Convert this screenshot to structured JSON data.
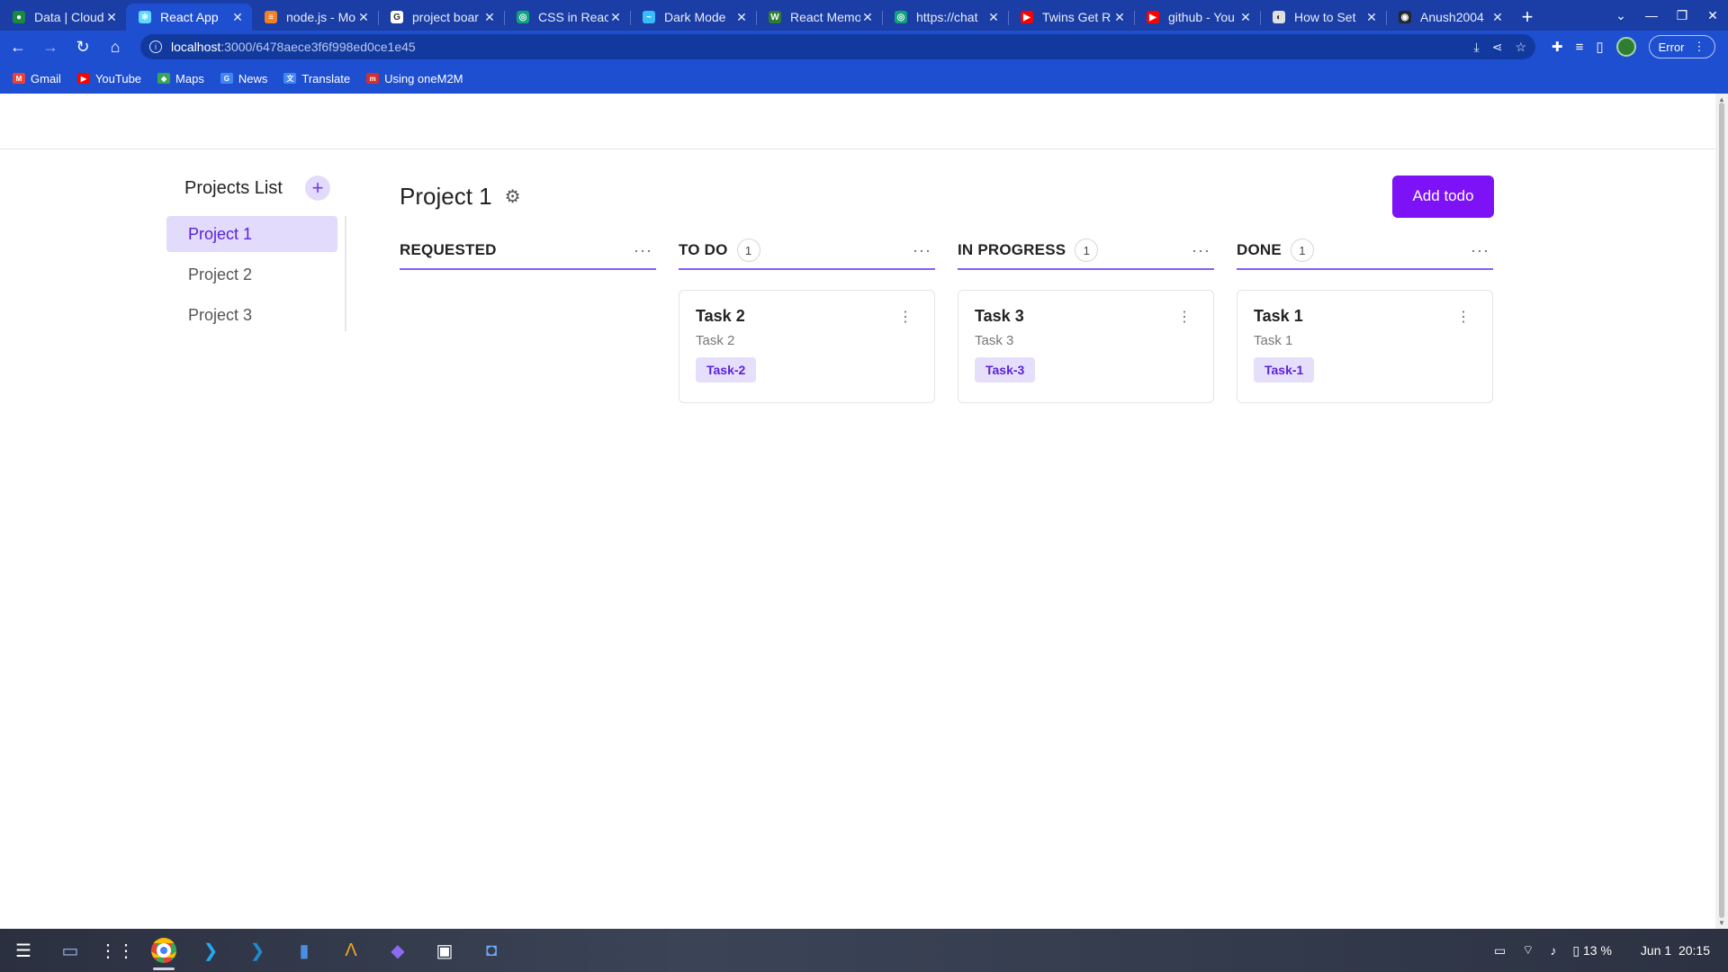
{
  "browser": {
    "tabs": [
      {
        "label": "Data | Cloud",
        "color": "#1b8a3f",
        "glyph": "●"
      },
      {
        "label": "React App",
        "color": "#61dafb",
        "glyph": "⚛",
        "active": true
      },
      {
        "label": "node.js - Mo",
        "color": "#f48024",
        "glyph": "≡"
      },
      {
        "label": "project boar",
        "color": "#ffffff",
        "glyph": "G"
      },
      {
        "label": "CSS in React",
        "color": "#10a37f",
        "glyph": "◎"
      },
      {
        "label": "Dark Mode",
        "color": "#38bdf8",
        "glyph": "~"
      },
      {
        "label": "React Memo",
        "color": "#2e7d32",
        "glyph": "W"
      },
      {
        "label": "https://chat",
        "color": "#10a37f",
        "glyph": "◎"
      },
      {
        "label": "Twins Get R",
        "color": "#ff0000",
        "glyph": "▶"
      },
      {
        "label": "github - You",
        "color": "#ff0000",
        "glyph": "▶"
      },
      {
        "label": "How to Set",
        "color": "#e0e0e0",
        "glyph": "◐"
      },
      {
        "label": "Anush2004",
        "color": "#24292f",
        "glyph": "◉"
      }
    ],
    "new_tab": "+",
    "url_host": "localhost",
    "url_path": ":3000/6478aece3f6f998ed0ce1e45",
    "error_label": "Error",
    "bookmarks": [
      {
        "label": "Gmail",
        "color": "#ea4335",
        "glyph": "M"
      },
      {
        "label": "YouTube",
        "color": "#ff0000",
        "glyph": "▶"
      },
      {
        "label": "Maps",
        "color": "#34a853",
        "glyph": "◆"
      },
      {
        "label": "News",
        "color": "#4285f4",
        "glyph": "G"
      },
      {
        "label": "Translate",
        "color": "#4285f4",
        "glyph": "文"
      },
      {
        "label": "Using oneM2M",
        "color": "#d32f2f",
        "glyph": "m"
      }
    ]
  },
  "sidebar": {
    "title": "Projects List",
    "add_glyph": "+",
    "projects": [
      "Project 1",
      "Project 2",
      "Project 3"
    ],
    "active_index": 0
  },
  "main": {
    "title": "Project 1",
    "add_todo_label": "Add todo",
    "columns": [
      {
        "title": "REQUESTED",
        "count": null,
        "cards": []
      },
      {
        "title": "TO DO",
        "count": "1",
        "cards": [
          {
            "title": "Task 2",
            "desc": "Task 2",
            "tag": "Task-2"
          }
        ]
      },
      {
        "title": "IN PROGRESS",
        "count": "1",
        "cards": [
          {
            "title": "Task 3",
            "desc": "Task 3",
            "tag": "Task-3"
          }
        ]
      },
      {
        "title": "DONE",
        "count": "1",
        "cards": [
          {
            "title": "Task 1",
            "desc": "Task 1",
            "tag": "Task-1"
          }
        ]
      }
    ]
  },
  "taskbar": {
    "battery": "13 %",
    "date": "Jun 1",
    "time": "20:15"
  },
  "colors": {
    "accent": "#7c12f5",
    "accent_light": "#e2dbfb",
    "browser_blue": "#1f4fd1"
  }
}
